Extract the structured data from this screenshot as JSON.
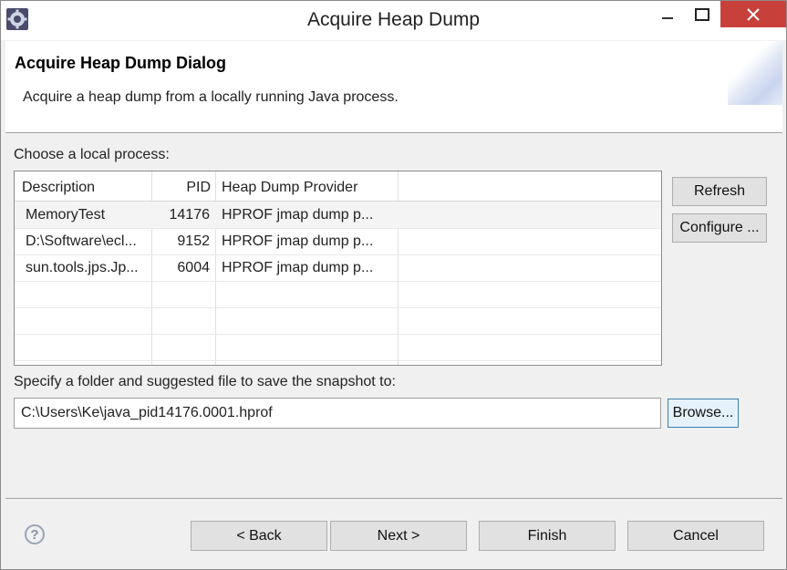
{
  "window": {
    "title": "Acquire Heap Dump",
    "icons": {
      "app": "eclipse-gear-icon",
      "minimize": "minimize-icon",
      "maximize": "maximize-icon",
      "close": "close-icon"
    },
    "colors": {
      "close_bg": "#c7413a",
      "focus_border": "#3c7fb1"
    }
  },
  "banner": {
    "title": "Acquire Heap Dump Dialog",
    "message": "Acquire a heap dump from a locally running Java process."
  },
  "process_label": "Choose a local process:",
  "table": {
    "headers": {
      "description": "Description",
      "pid": "PID",
      "provider": "Heap Dump Provider"
    },
    "rows": [
      {
        "description": "MemoryTest",
        "pid": "14176",
        "provider": "HPROF jmap dump p..."
      },
      {
        "description": "D:\\Software\\ecl...",
        "pid": "9152",
        "provider": "HPROF jmap dump p..."
      },
      {
        "description": "sun.tools.jps.Jp...",
        "pid": "6004",
        "provider": "HPROF jmap dump p..."
      }
    ]
  },
  "side_buttons": {
    "refresh": "Refresh",
    "configure": "Configure ..."
  },
  "folder_label": "Specify a folder and suggested file to save the snapshot to:",
  "path_value": "C:\\Users\\Ke\\java_pid14176.0001.hprof",
  "browse": "Browse...",
  "footer": {
    "help_icon": "help-icon",
    "help_glyph": "?",
    "back": "< Back",
    "next": "Next >",
    "finish": "Finish",
    "cancel": "Cancel"
  }
}
